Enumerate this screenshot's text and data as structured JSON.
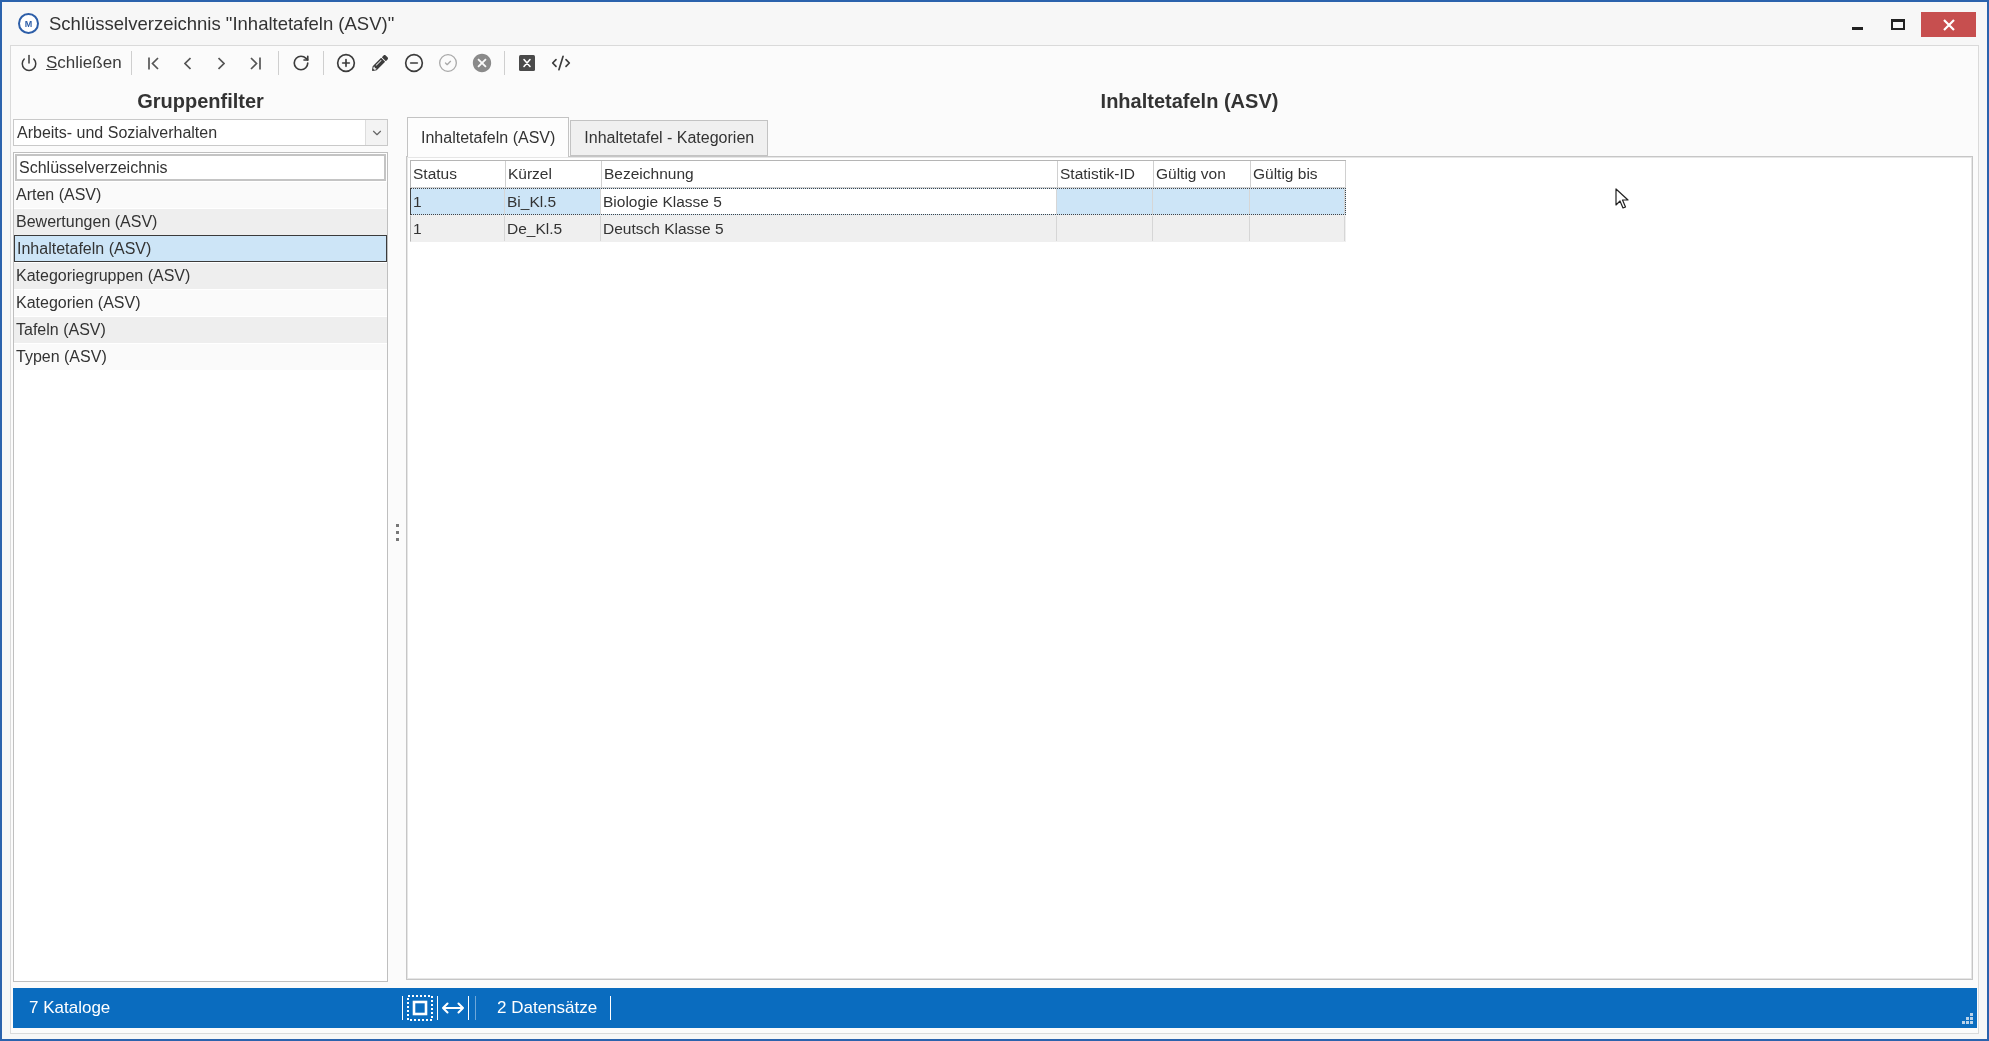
{
  "window": {
    "logo_text": "M",
    "title": "Schlüsselverzeichnis \"Inhaltetafeln (ASV)\""
  },
  "toolbar": {
    "groups": [
      [
        {
          "kind": "close",
          "label": "Schließen",
          "access_key_underlined": true,
          "disabled": false
        }
      ],
      [
        {
          "kind": "first",
          "disabled": false
        },
        {
          "kind": "previous",
          "disabled": false
        },
        {
          "kind": "next",
          "disabled": false
        },
        {
          "kind": "last",
          "disabled": false
        }
      ],
      [
        {
          "kind": "refresh",
          "disabled": false
        }
      ],
      [
        {
          "kind": "add",
          "disabled": false
        },
        {
          "kind": "edit",
          "disabled": false
        },
        {
          "kind": "remove",
          "disabled": false
        },
        {
          "kind": "save",
          "disabled": true
        },
        {
          "kind": "cancel",
          "disabled": true
        }
      ],
      [
        {
          "kind": "export",
          "disabled": false
        },
        {
          "kind": "source",
          "disabled": false
        }
      ]
    ]
  },
  "group_filter": {
    "title": "Gruppenfilter",
    "dropdown": {
      "value": "Arbeits- und Sozialverhalten"
    },
    "list": {
      "header": "Schlüsselverzeichnis",
      "items": [
        {
          "label": "Arten (ASV)",
          "selected": false
        },
        {
          "label": "Bewertungen (ASV)",
          "selected": false
        },
        {
          "label": "Inhaltetafeln (ASV)",
          "selected": true
        },
        {
          "label": "Kategoriegruppen (ASV)",
          "selected": false
        },
        {
          "label": "Kategorien (ASV)",
          "selected": false
        },
        {
          "label": "Tafeln (ASV)",
          "selected": false
        },
        {
          "label": "Typen (ASV)",
          "selected": false
        }
      ]
    }
  },
  "detail": {
    "title": "Inhaltetafeln (ASV)",
    "tabs": [
      {
        "label": "Inhaltetafeln (ASV)",
        "selected": true
      },
      {
        "label": "Inhaltetafel - Kategorien",
        "selected": false
      }
    ],
    "table": {
      "columns": [
        "Status",
        "Kürzel",
        "Bezeichnung",
        "Statistik-ID",
        "Gültig von",
        "Gültig bis"
      ],
      "rows": [
        {
          "selected": true,
          "cells": [
            {
              "text": "1",
              "focused": false
            },
            {
              "text": "Bi_Kl.5",
              "focused": false
            },
            {
              "text": "Biologie Klasse 5",
              "focused": true
            }
          ]
        },
        {
          "selected": false,
          "cells": [
            {
              "text": "1",
              "focused": false
            },
            {
              "text": "De_Kl.5",
              "focused": false
            },
            {
              "text": "Deutsch Klasse 5",
              "focused": false
            }
          ]
        }
      ]
    }
  },
  "status_bar": {
    "catalog_count": "7 Kataloge",
    "record_count": "2 Datensätze"
  }
}
